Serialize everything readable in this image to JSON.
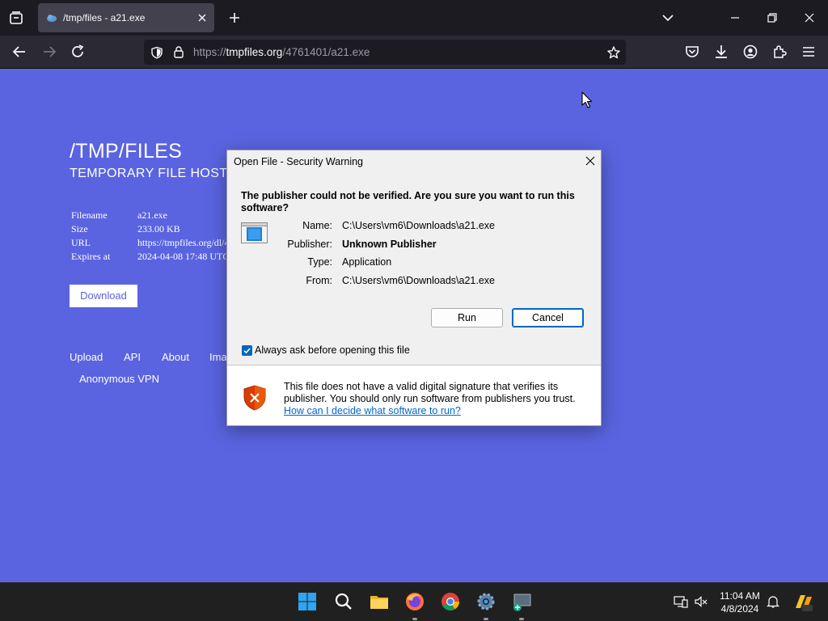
{
  "browser": {
    "tab_title": "/tmp/files - a21.exe",
    "url_prefix": "https://",
    "url_host": "tmpfiles.org",
    "url_path": "/4761401/a21.exe"
  },
  "page": {
    "title": "/TMP/FILES",
    "subtitle": "TEMPORARY FILE HOSTI",
    "meta": [
      {
        "key": "Filename",
        "value": "a21.exe"
      },
      {
        "key": "Size",
        "value": "233.00 KB"
      },
      {
        "key": "URL",
        "value": "https://tmpfiles.org/dl/4"
      },
      {
        "key": "Expires at",
        "value": "2024-04-08 17:48 UTC"
      }
    ],
    "download_label": "Download",
    "links": [
      "Upload",
      "API",
      "About",
      "Ima"
    ],
    "vpn_link": "Anonymous VPN"
  },
  "dialog": {
    "title": "Open File - Security Warning",
    "heading": "The publisher could not be verified.  Are you sure you want to run this software?",
    "fields": [
      {
        "label": "Name:",
        "value": "C:\\Users\\vm6\\Downloads\\a21.exe"
      },
      {
        "label": "Publisher:",
        "value": "Unknown Publisher"
      },
      {
        "label": "Type:",
        "value": "Application"
      },
      {
        "label": "From:",
        "value": "C:\\Users\\vm6\\Downloads\\a21.exe"
      }
    ],
    "run_label": "Run",
    "cancel_label": "Cancel",
    "checkbox_label": "Always ask before opening this file",
    "checkbox_checked": true,
    "warning_text": "This file does not have a valid digital signature that verifies its publisher.  You should only run software from publishers you trust.",
    "warning_link": "How can I decide what software to run?"
  },
  "taskbar": {
    "time": "11:04 AM",
    "date": "4/8/2024",
    "apps": [
      "start-icon",
      "search-icon",
      "file-explorer-icon",
      "firefox-icon",
      "chrome-icon",
      "settings-icon",
      "remote-desktop-icon"
    ]
  },
  "colors": {
    "page_bg": "#5a64e0",
    "browser_tabbar": "#1c1b22",
    "browser_navbar": "#2b2a33",
    "dialog_bg": "#f0f0f0",
    "accent_blue": "#0067c0",
    "link_blue": "#0066cc",
    "taskbar_bg": "#202020"
  }
}
